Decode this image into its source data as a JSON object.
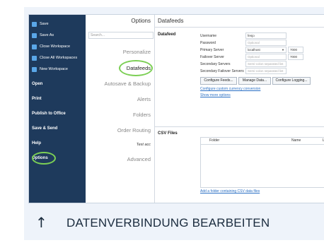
{
  "sidebar": {
    "items": [
      {
        "label": "Save"
      },
      {
        "label": "Save As"
      },
      {
        "label": "Close Workspace"
      },
      {
        "label": "Close All Workspaces"
      },
      {
        "label": "New Workspace"
      },
      {
        "label": "Open"
      },
      {
        "label": "Print"
      },
      {
        "label": "Publish to Office"
      },
      {
        "label": "Save & Send"
      },
      {
        "label": "Help"
      },
      {
        "label": "Options"
      }
    ]
  },
  "options": {
    "title": "Options",
    "search_placeholder": "Search...",
    "categories": [
      {
        "label": "Personalize"
      },
      {
        "label": "Datafeeds"
      },
      {
        "label": "Autosave & Backup"
      },
      {
        "label": "Alerts"
      },
      {
        "label": "Folders"
      },
      {
        "label": "Order Routing"
      },
      {
        "label": "Test acc"
      },
      {
        "label": "Advanced"
      }
    ]
  },
  "content": {
    "title": "Datafeeds",
    "datafeed_section": "Datafeed",
    "fields": [
      {
        "label": "Username",
        "value": "fenjo"
      },
      {
        "label": "Password",
        "value": "Optional"
      },
      {
        "label": "Primary Server",
        "value": "localhost",
        "port": "7000"
      },
      {
        "label": "Failover Server",
        "value": "Optional",
        "port": "7000"
      },
      {
        "label": "Secondary Servers",
        "value": "Semi-colon separated list"
      },
      {
        "label": "Secondary Failover Servers",
        "value": "Semi-colon separated list"
      }
    ],
    "buttons": [
      {
        "label": "Configure Feeds..."
      },
      {
        "label": "Manage Data..."
      },
      {
        "label": "Configure Logging..."
      }
    ],
    "link_currency": "Configure custom currency conversion",
    "link_more": "Show more options",
    "csv_section": "CSV Files",
    "csv_columns": [
      "Folder",
      "Name",
      "L"
    ],
    "link_add_folder": "Add a folder containing CSV data files"
  },
  "footer": {
    "arrow": "↑",
    "text": "DATENVERBINDUNG BEARBEITEN"
  },
  "colors": {
    "sidebar_bg": "#1e3a5c",
    "highlight_ring": "#7ccf55",
    "link": "#2a6fc4",
    "frame_bg": "#eef3fa"
  }
}
